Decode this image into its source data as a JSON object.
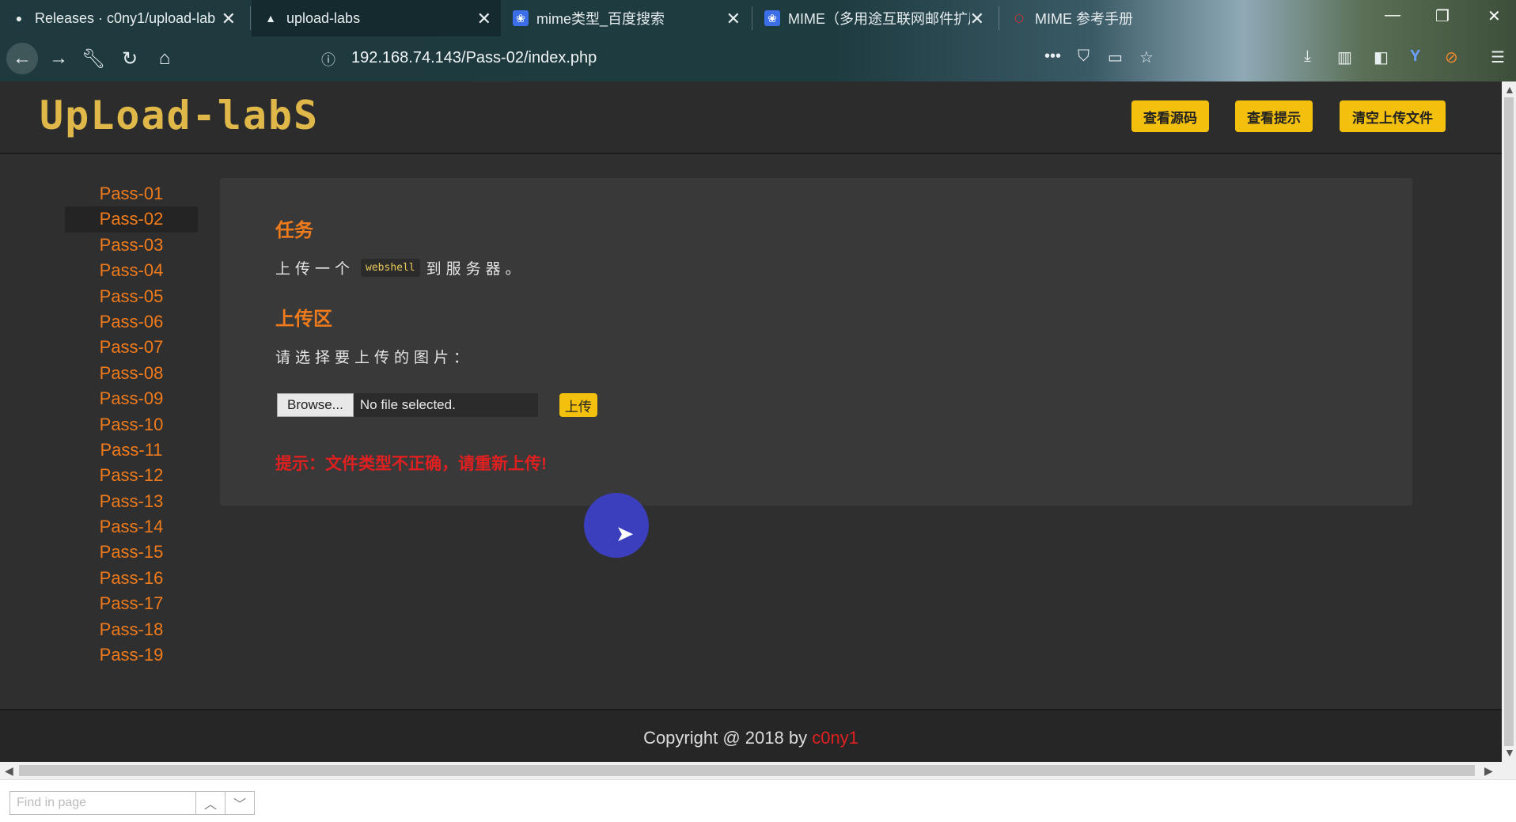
{
  "browser": {
    "tabs": [
      {
        "title": "Releases · c0ny1/upload-lab",
        "icon": "github-icon"
      },
      {
        "title": "upload-labs",
        "icon": "site-icon"
      },
      {
        "title": "mime类型_百度搜索",
        "icon": "baidu-paw-icon"
      },
      {
        "title": "MIME（多用途互联网邮件扩展",
        "icon": "baidu-paw-icon"
      },
      {
        "title": "MIME 参考手册",
        "icon": "w3school-icon"
      }
    ],
    "url": "192.168.74.143/Pass-02/index.php"
  },
  "header": {
    "logo": "UpLoad-labS",
    "buttons": [
      "查看源码",
      "查看提示",
      "清空上传文件"
    ]
  },
  "sidebar": {
    "items": [
      "Pass-01",
      "Pass-02",
      "Pass-03",
      "Pass-04",
      "Pass-05",
      "Pass-06",
      "Pass-07",
      "Pass-08",
      "Pass-09",
      "Pass-10",
      "Pass-11",
      "Pass-12",
      "Pass-13",
      "Pass-14",
      "Pass-15",
      "Pass-16",
      "Pass-17",
      "Pass-18",
      "Pass-19"
    ],
    "active": "Pass-02"
  },
  "main": {
    "task_heading": "任务",
    "task_before": "上传一个",
    "task_code": "webshell",
    "task_after": "到服务器。",
    "upload_heading": "上传区",
    "select_label": "请选择要上传的图片：",
    "browse_label": "Browse...",
    "file_status": "No file selected.",
    "upload_label": "上传",
    "error_msg": "提示：文件类型不正确，请重新上传!"
  },
  "footer": {
    "copyright": "Copyright @ 2018 by",
    "author": "c0ny1"
  },
  "findbar": {
    "placeholder": "Find in page"
  },
  "colors": {
    "accent": "#f07b1c",
    "button": "#f4c00e",
    "error": "#e02020"
  }
}
